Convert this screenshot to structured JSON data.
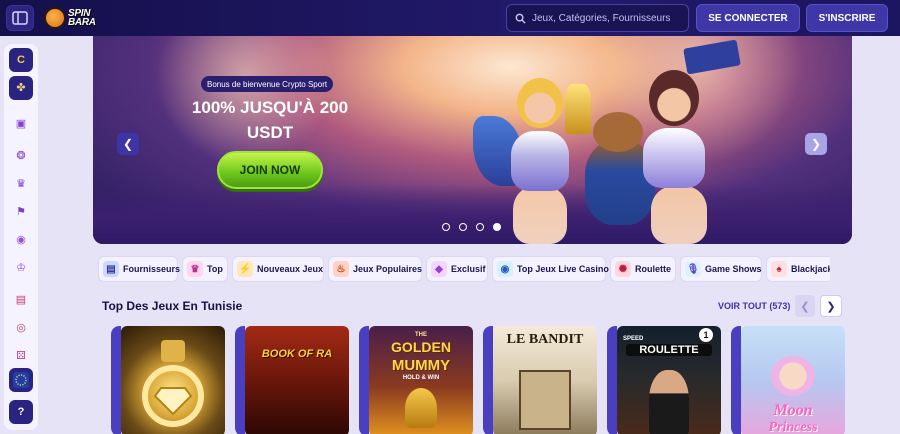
{
  "header": {
    "logo_text_line1": "SPIN",
    "logo_text_line2": "BARA",
    "search_placeholder": "Jeux, Catégories, Fournisseurs",
    "login_label": "SE CONNECTER",
    "register_label": "S'INSCRIRE"
  },
  "rail": {
    "items": [
      {
        "icon": "crypto-coin-icon"
      },
      {
        "icon": "clover-icon"
      },
      {
        "icon": "gift-icon"
      },
      {
        "icon": "medal-icon"
      },
      {
        "icon": "trophy-icon"
      },
      {
        "icon": "race-flag-icon"
      },
      {
        "icon": "chat-icon"
      },
      {
        "icon": "crown-icon"
      },
      {
        "icon": "ticket-icon"
      },
      {
        "icon": "target-icon"
      },
      {
        "icon": "dice-icon"
      },
      {
        "icon": "eu-flag-icon"
      },
      {
        "icon": "help-icon"
      }
    ]
  },
  "banner": {
    "bonus_pill": "Bonus de bienvenue Crypto Sport",
    "title_line1": "100% JUSQU'À 200",
    "title_line2": "USDT",
    "cta_label": "JOIN NOW",
    "active_slide": 4,
    "slide_count": 4
  },
  "categories": [
    {
      "label": "Fournisseurs",
      "icon": "providers-icon",
      "color": "#c9d9ff"
    },
    {
      "label": "Top",
      "icon": "crown-icon",
      "color": "#ffd6f2"
    },
    {
      "label": "Nouveaux Jeux",
      "icon": "lightning-icon",
      "color": "#ffe8b5"
    },
    {
      "label": "Jeux Populaires",
      "icon": "flame-icon",
      "color": "#ffd3c4"
    },
    {
      "label": "Exclusif",
      "icon": "diamond-icon",
      "color": "#f2d6ff"
    },
    {
      "label": "Top Jeux Live Casino",
      "icon": "live-icon",
      "color": "#d6f0ff"
    },
    {
      "label": "Roulette",
      "icon": "roulette-icon",
      "color": "#ffd6e0"
    },
    {
      "label": "Game Shows",
      "icon": "microphone-icon",
      "color": "#dff2ff"
    },
    {
      "label": "Blackjack",
      "icon": "cards-icon",
      "color": "#ffe0e0"
    }
  ],
  "section": {
    "title": "Top Des Jeux En Tunisie",
    "see_all": "VOIR TOUT (573)"
  },
  "games": [
    {
      "title": "",
      "bg_top": "#3a2a12",
      "bg_bottom": "#d4a53a"
    },
    {
      "title": "BOOK OF RA",
      "bg_top": "#8a1f12",
      "bg_bottom": "#3c0c07"
    },
    {
      "title_top": "THE",
      "title": "GOLDEN",
      "title2": "MUMMY",
      "subtitle": "HOLD & WIN",
      "bg_top": "#3a1a3e",
      "bg_bottom": "#c46a1c"
    },
    {
      "title": "LE BANDIT",
      "bg_top": "#f0e6d2",
      "bg_bottom": "#8b7a5a"
    },
    {
      "provider": "SPEED",
      "title": "ROULETTE",
      "badge": "1",
      "bg_top": "#1a2a3a",
      "bg_bottom": "#4a2a1a"
    },
    {
      "title": "Moon",
      "title2": "Princess",
      "bg_top": "#b8d6f5",
      "bg_bottom": "#e9a8e0"
    }
  ]
}
